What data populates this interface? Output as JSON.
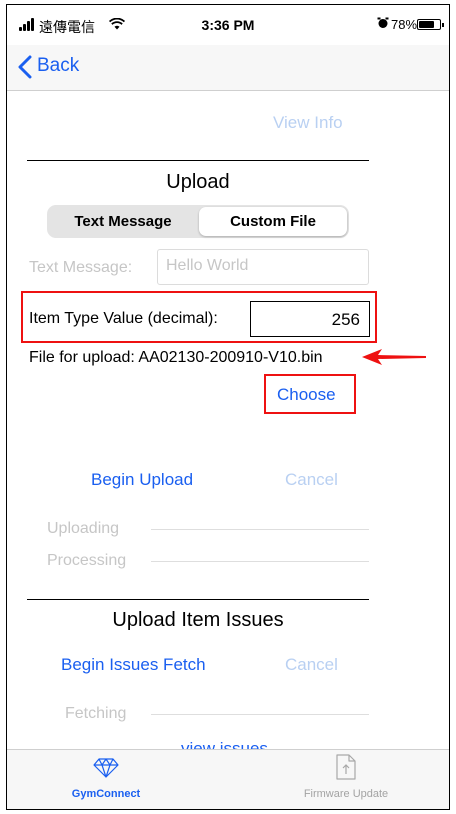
{
  "status_bar": {
    "carrier": "遠傳電信",
    "time": "3:36 PM",
    "battery": "78%",
    "battery_level": 0.78
  },
  "nav": {
    "back_label": "Back"
  },
  "view_info_label": "View Info",
  "upload_section": {
    "title": "Upload",
    "segments": [
      "Text Message",
      "Custom File"
    ],
    "selected_segment": "Custom File",
    "text_message_label": "Text Message:",
    "text_message_value": "Hello World",
    "item_type_label": "Item Type Value (decimal):",
    "item_type_value": "256",
    "file_text": "File for upload: AA02130-200910-V10.bin",
    "choose_label": "Choose",
    "begin_upload_label": "Begin Upload",
    "cancel_label": "Cancel",
    "uploading_label": "Uploading",
    "processing_label": "Processing"
  },
  "issues_section": {
    "title": "Upload Item Issues",
    "begin_fetch_label": "Begin Issues Fetch",
    "cancel_label": "Cancel",
    "fetching_label": "Fetching",
    "view_issues_label": "view issues"
  },
  "tab_bar": {
    "tabs": [
      {
        "label": "GymConnect",
        "icon": "diamond-icon",
        "selected": true
      },
      {
        "label": "Firmware Update",
        "icon": "document-upload-icon",
        "selected": false
      }
    ]
  },
  "colors": {
    "link": "#1a5ff0",
    "link_disabled": "#b9d0f2",
    "highlight": "#ee1111",
    "disabled_text": "#c6c6c6"
  }
}
